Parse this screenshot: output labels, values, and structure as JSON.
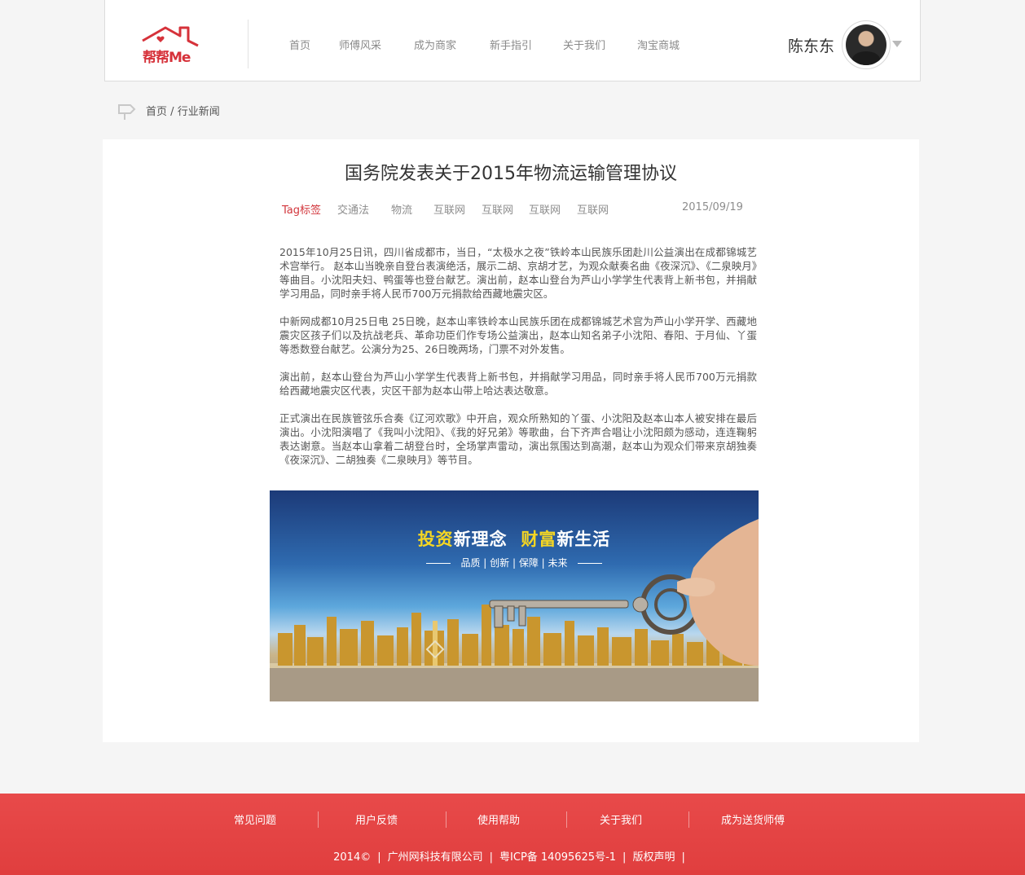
{
  "header": {
    "logo_text": "帮帮Me",
    "nav": [
      "首页",
      "师傅风采",
      "成为商家",
      "新手指引",
      "关于我们",
      "淘宝商城"
    ],
    "username": "陈东东"
  },
  "breadcrumb": {
    "home": "首页",
    "separator": "/",
    "current": "行业新闻"
  },
  "article": {
    "title": "国务院发表关于2015年物流运输管理协议",
    "tag_label": "Tag标签",
    "tags": [
      "交通法",
      "物流",
      "互联网",
      "互联网",
      "互联网",
      "互联网"
    ],
    "date": "2015/09/19",
    "paragraphs": [
      "2015年10月25日讯，四川省成都市，当日，“太极水之夜”铁岭本山民族乐团赴川公益演出在成都锦城艺术宫举行。 赵本山当晚亲自登台表演绝活，展示二胡、京胡才艺，为观众献奏名曲《夜深沉》、《二泉映月》等曲目。小沈阳夫妇、鸭蛋等也登台献艺。演出前，赵本山登台为芦山小学学生代表背上新书包，并捐献学习用品，同时亲手将人民币700万元捐款给西藏地震灾区。",
      "中新网成都10月25日电 25日晚，赵本山率铁岭本山民族乐团在成都锦城艺术宫为芦山小学开学、西藏地震灾区孩子们以及抗战老兵、革命功臣们作专场公益演出，赵本山知名弟子小沈阳、春阳、于月仙、丫蛋等悉数登台献艺。公演分为25、26日晚两场，门票不对外发售。",
      "演出前，赵本山登台为芦山小学学生代表背上新书包，并捐献学习用品，同时亲手将人民币700万元捐款给西藏地震灾区代表，灾区干部为赵本山带上哈达表达敬意。",
      "正式演出在民族管弦乐合奏《辽河欢歌》中开启，观众所熟知的丫蛋、小沈阳及赵本山本人被安排在最后演出。小沈阳演唱了《我叫小沈阳》、《我的好兄弟》等歌曲，台下齐声合唱让小沈阳颇为感动，连连鞠躬表达谢意。当赵本山拿着二胡登台时，全场掌声雷动，演出氛围达到高潮，赵本山为观众们带来京胡独奏《夜深沉》、二胡独奏《二泉映月》等节目。"
    ],
    "banner": {
      "title_part1_highlight": "投资",
      "title_part2": "新理念",
      "title_part3_highlight": "财富",
      "title_part4": "新生活",
      "subtitle": "品质 | 创新 | 保障 | 未来"
    }
  },
  "footer": {
    "links": [
      "常见问题",
      "用户反馈",
      "使用帮助",
      "关于我们",
      "成为送货师傅"
    ],
    "copyright": [
      "2014©",
      "广州网科技有限公司",
      "粤ICP备 14095625号-1",
      "版权声明"
    ]
  },
  "colors": {
    "accent_red": "#d2363c",
    "footer_red": "#e44444",
    "banner_highlight": "#f5d623"
  }
}
